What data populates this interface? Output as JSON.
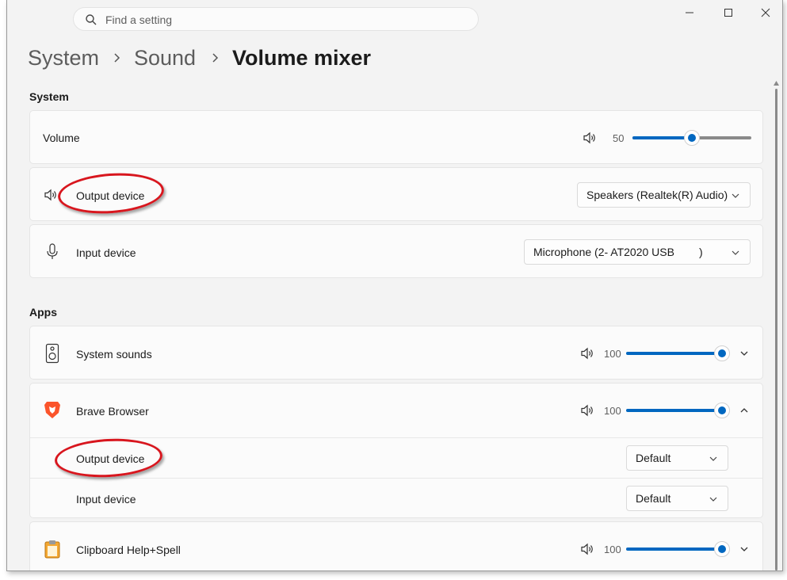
{
  "search": {
    "placeholder": "Find a setting"
  },
  "breadcrumb": [
    "System",
    "Sound",
    "Volume mixer"
  ],
  "sections": {
    "system": "System",
    "apps": "Apps"
  },
  "system": {
    "volume": {
      "label": "Volume",
      "value": "50",
      "level": 0.5
    },
    "output": {
      "label": "Output device",
      "selected": "Speakers (Realtek(R) Audio)"
    },
    "input": {
      "label": "Input device",
      "selected": "Microphone (2- AT2020 USB        )"
    }
  },
  "apps": [
    {
      "name": "System sounds",
      "value": "100",
      "level": 1.0,
      "icon": "speaker-device-icon"
    },
    {
      "name": "Brave Browser",
      "value": "100",
      "level": 1.0,
      "icon": "brave-lion-icon",
      "output_label": "Output device",
      "output_selected": "Default",
      "input_label": "Input device",
      "input_selected": "Default"
    },
    {
      "name": "Clipboard Help+Spell",
      "value": "100",
      "level": 1.0,
      "icon": "clipboard-icon"
    }
  ],
  "colors": {
    "accent": "#0067c0",
    "annotation": "#d8161e",
    "background": "#f3f3f3"
  }
}
